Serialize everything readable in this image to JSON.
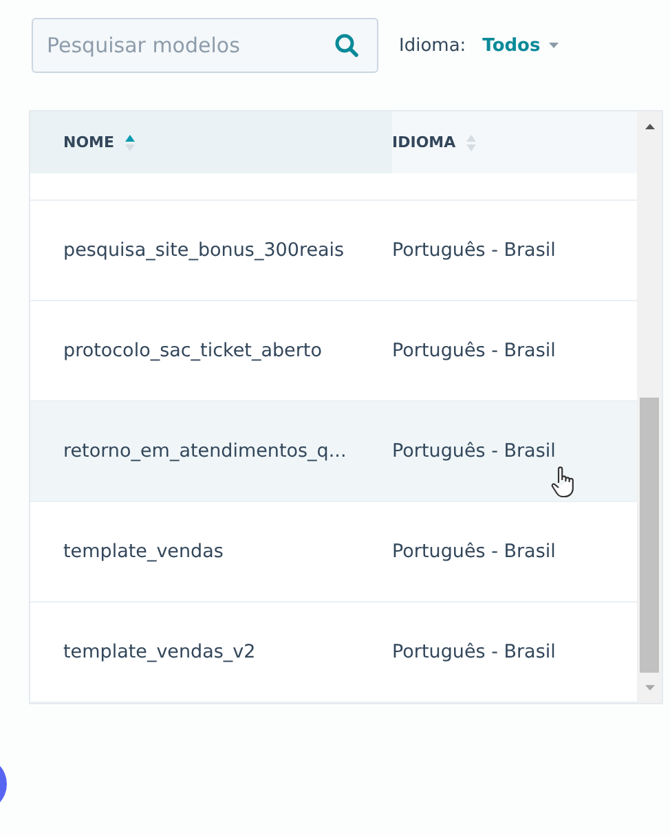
{
  "search": {
    "placeholder": "Pesquisar modelos"
  },
  "filter": {
    "label": "Idioma:",
    "value": "Todos"
  },
  "table": {
    "columns": [
      {
        "label": "NOME",
        "sorted": true
      },
      {
        "label": "IDIOMA",
        "sorted": false
      }
    ],
    "rows": [
      {
        "name": "pesquisa_site_bonus_300reais",
        "language": "Português - Brasil",
        "hovered": false
      },
      {
        "name": "protocolo_sac_ticket_aberto",
        "language": "Português - Brasil",
        "hovered": false
      },
      {
        "name": "retorno_em_atendimentos_q...",
        "language": "Português - Brasil",
        "hovered": true
      },
      {
        "name": "template_vendas",
        "language": "Português - Brasil",
        "hovered": false
      },
      {
        "name": "template_vendas_v2",
        "language": "Português - Brasil",
        "hovered": false
      }
    ]
  }
}
